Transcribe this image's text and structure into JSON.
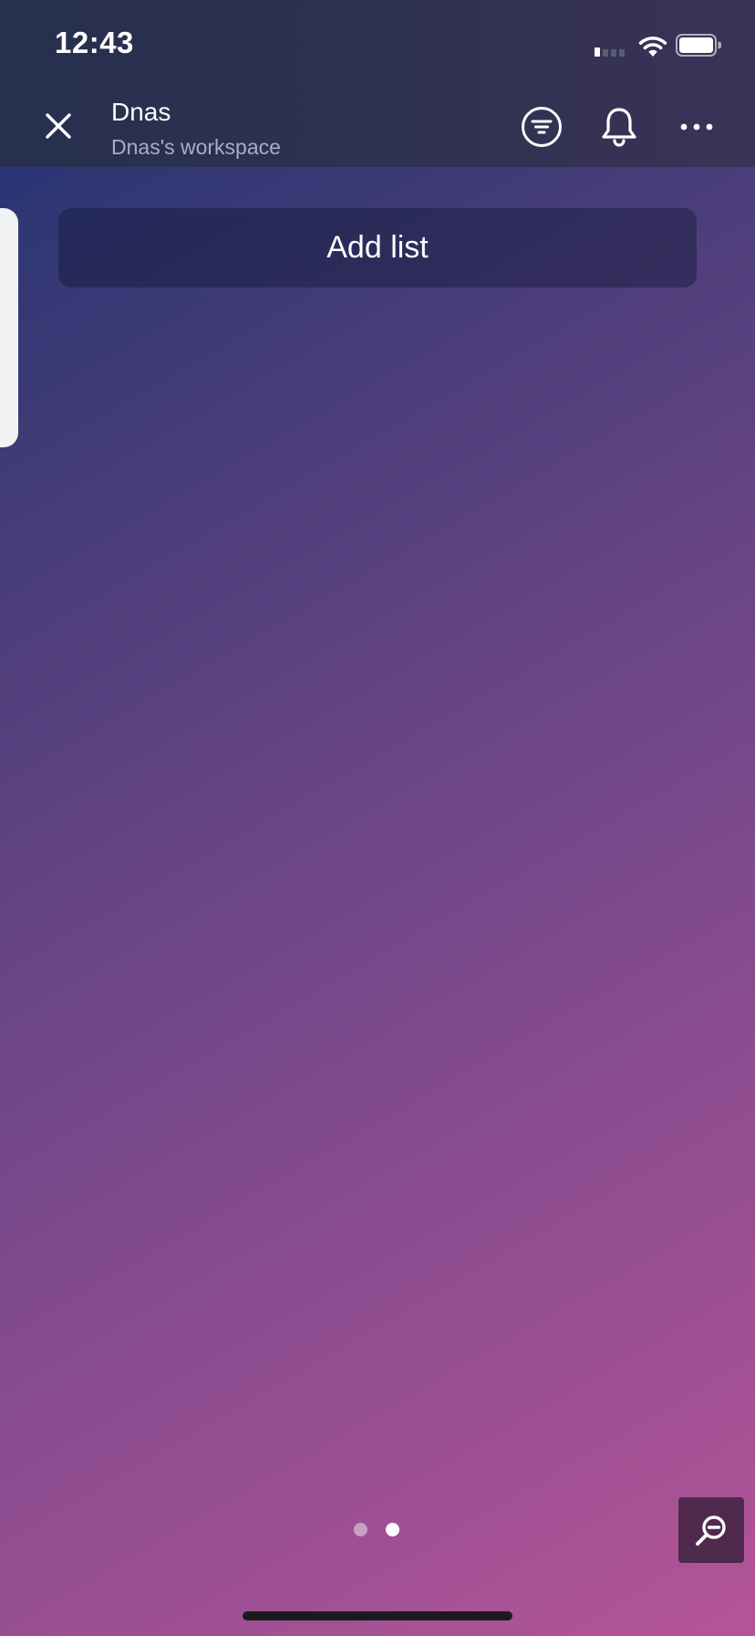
{
  "status_bar": {
    "time": "12:43",
    "signal_bars": 1,
    "battery_level": 1.0
  },
  "header": {
    "title": "Dnas",
    "subtitle": "Dnas's workspace",
    "icons": {
      "close": "close-icon",
      "filter": "filter-icon",
      "notifications": "bell-icon",
      "more": "more-icon"
    }
  },
  "board": {
    "add_list_label": "Add list",
    "page_count": 2,
    "current_page": 2
  },
  "zoom": {
    "icon": "zoom-out-icon"
  },
  "colors": {
    "header_bg": "#2f3150",
    "gradient_start": "#1e3273",
    "gradient_end": "#b45498",
    "card_bg": "#f1f2f4",
    "zoom_bg": "#4f2a4d",
    "subtitle": "#a8adc4"
  }
}
